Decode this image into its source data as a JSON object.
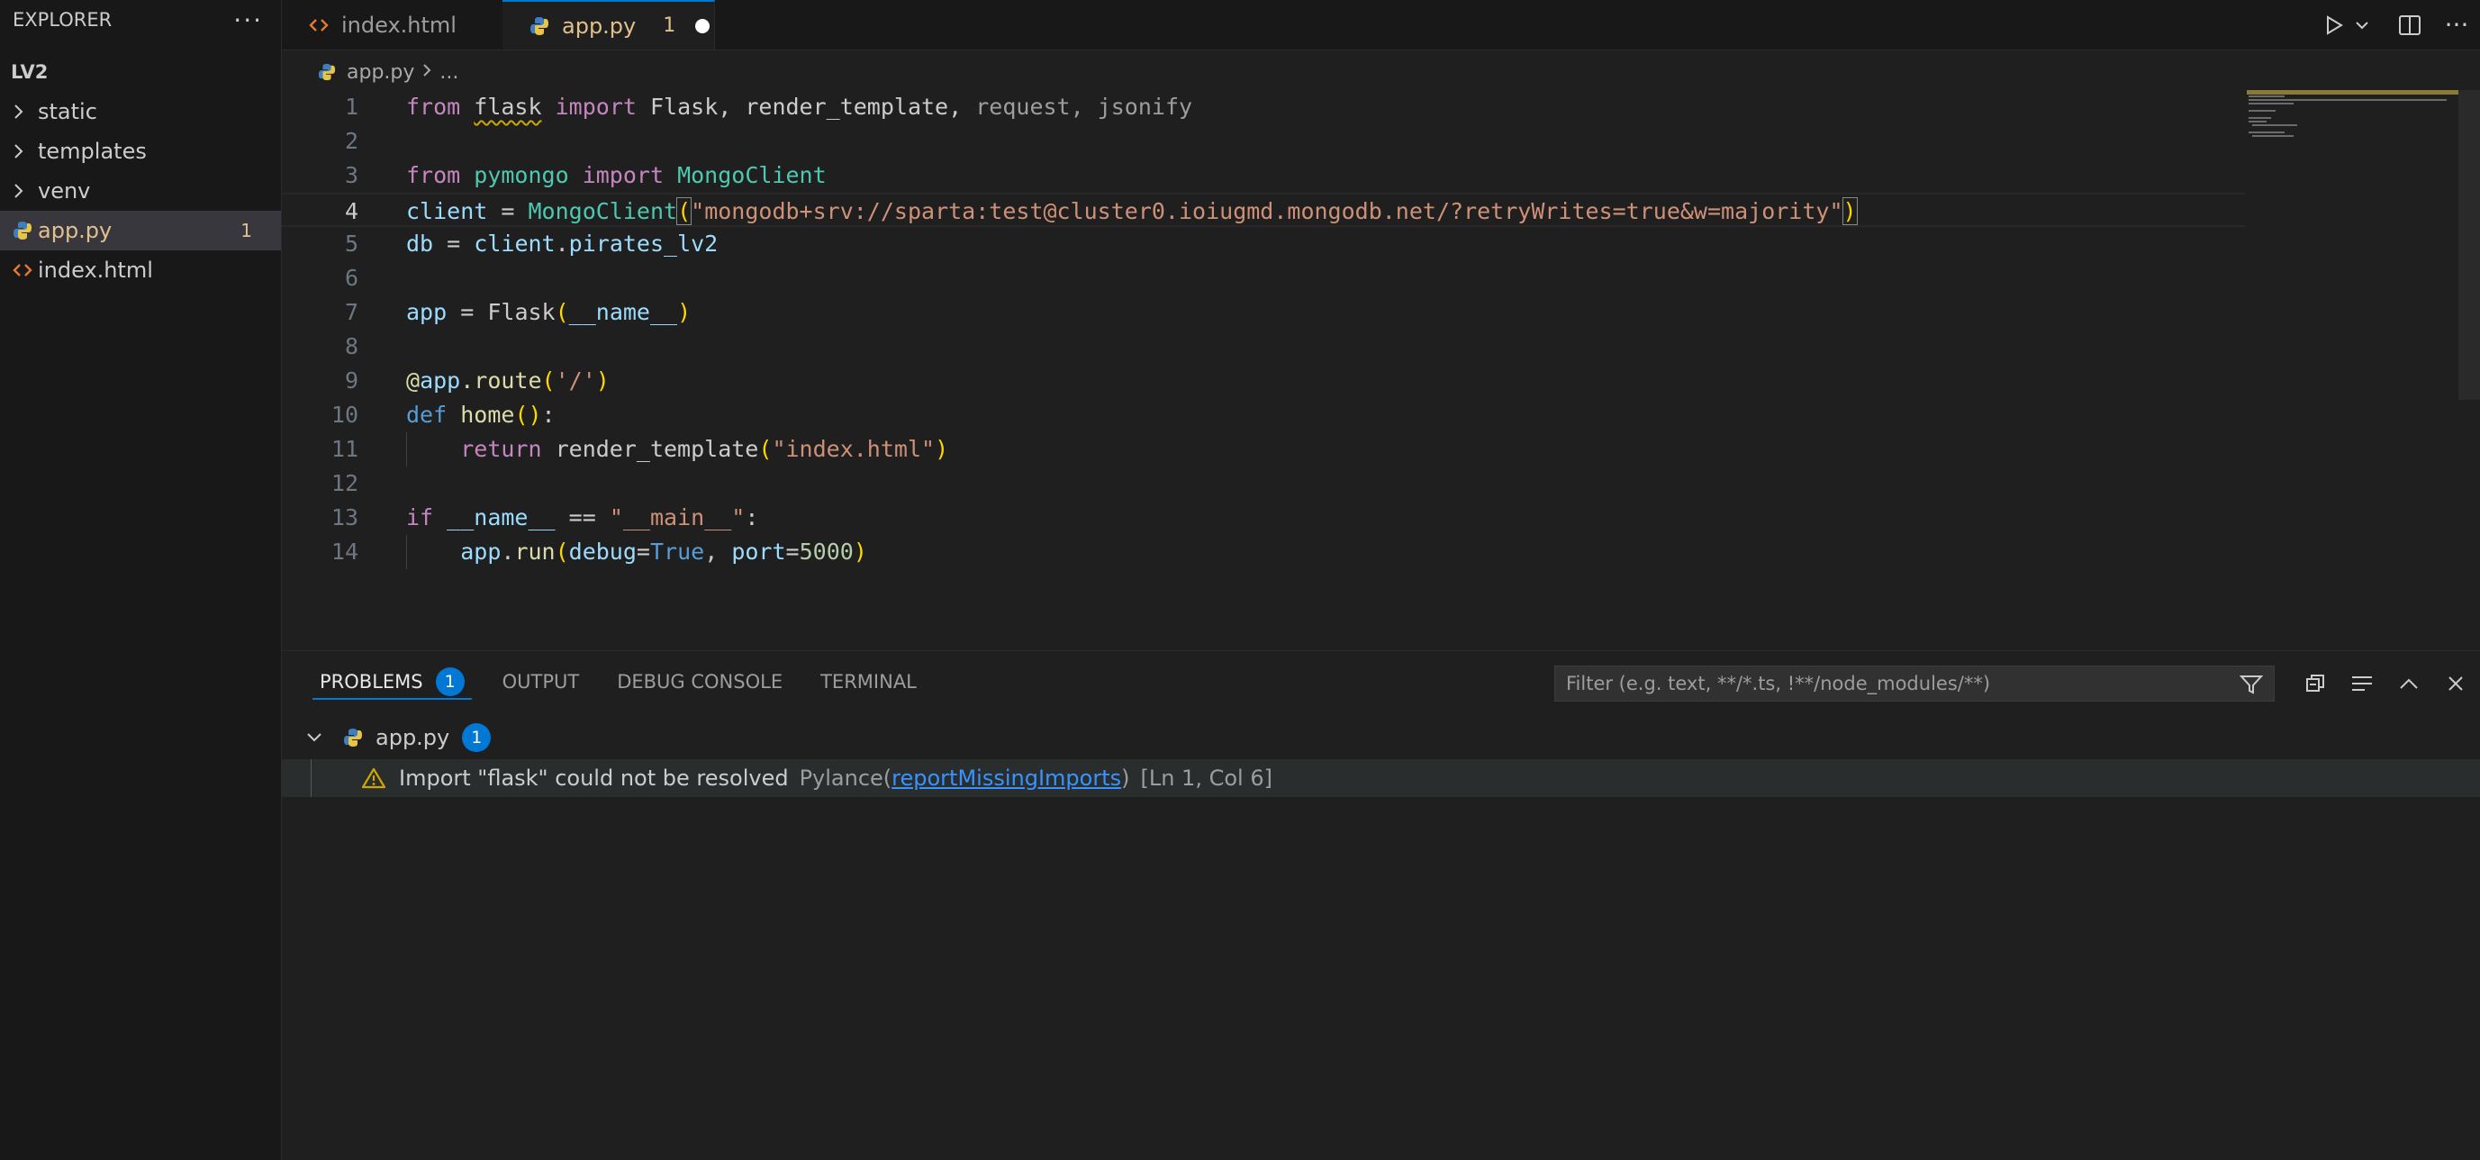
{
  "sidebar": {
    "title": "EXPLORER",
    "more": "···",
    "root": "LV2",
    "items": [
      {
        "label": "static",
        "kind": "folder",
        "icon": "chevron-right-icon"
      },
      {
        "label": "templates",
        "kind": "folder",
        "icon": "chevron-right-icon"
      },
      {
        "label": "venv",
        "kind": "folder",
        "icon": "chevron-right-icon"
      },
      {
        "label": "app.py",
        "kind": "file",
        "icon": "python-file-icon",
        "count": "1"
      },
      {
        "label": "index.html",
        "kind": "file",
        "icon": "html-file-icon"
      }
    ]
  },
  "tabs": [
    {
      "label": "index.html",
      "icon": "html-file-icon"
    },
    {
      "label": "app.py",
      "icon": "python-file-icon",
      "count": "1"
    }
  ],
  "breadcrumb": {
    "file": "app.py",
    "rest": "..."
  },
  "editor": {
    "line_numbers": [
      "1",
      "2",
      "3",
      "4",
      "5",
      "6",
      "7",
      "8",
      "9",
      "10",
      "11",
      "12",
      "13",
      "14"
    ]
  },
  "panel": {
    "tabs": [
      {
        "label": "PROBLEMS",
        "badge": "1"
      },
      {
        "label": "OUTPUT"
      },
      {
        "label": "DEBUG CONSOLE"
      },
      {
        "label": "TERMINAL"
      }
    ],
    "filter_placeholder": "Filter (e.g. text, **/*.ts, !**/node_modules/**)",
    "file": {
      "label": "app.py",
      "badge": "1"
    },
    "issue": {
      "message": "Import \"flask\" could not be resolved",
      "source": "Pylance(",
      "code": "reportMissingImports",
      "source_end": ")",
      "location": "[Ln 1, Col 6]"
    }
  },
  "colors": {
    "accent": "#0078d4",
    "modified": "#e2c08d",
    "warning": "#cca700"
  }
}
